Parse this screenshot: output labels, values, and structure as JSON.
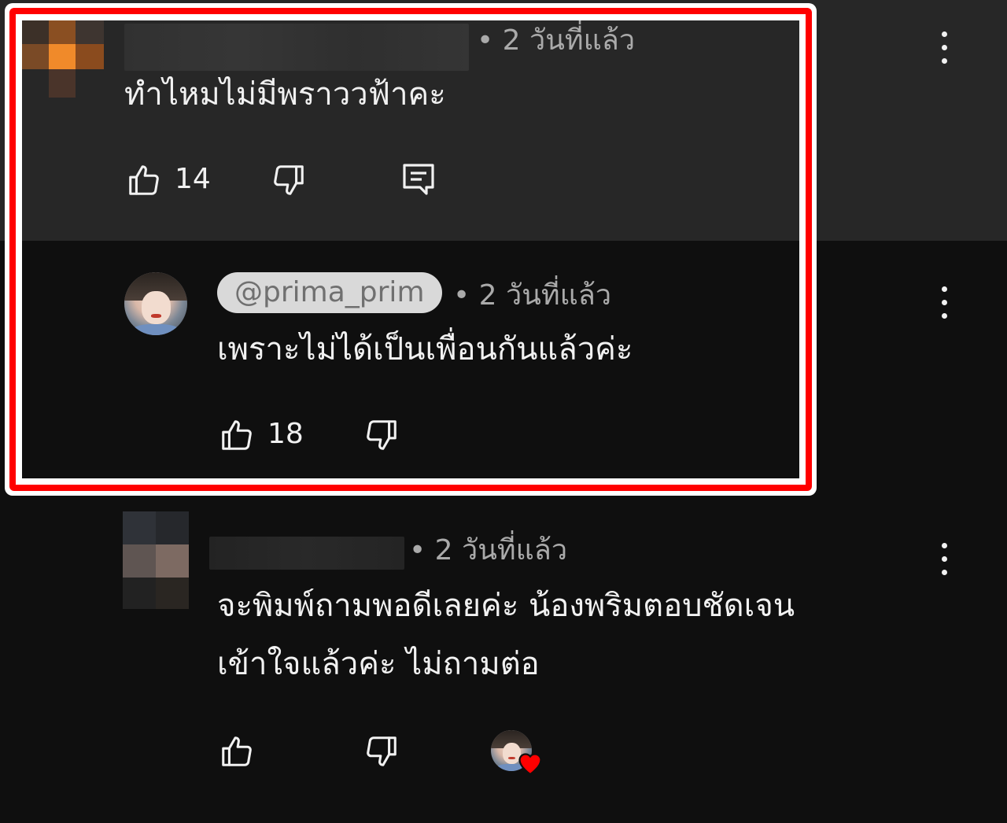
{
  "comments": [
    {
      "time": "• 2 วันที่แล้ว",
      "text": "ทำไหมไม่มีพราววฟ้าคะ",
      "likes": "14"
    },
    {
      "author": "@prima_prim",
      "time": "• 2 วันที่แล้ว",
      "text": "เพราะไม่ได้เป็นเพื่อนกันแล้วค่ะ",
      "likes": "18"
    },
    {
      "time": "• 2 วันที่แล้ว",
      "text_line1": "จะพิมพ์ถามพอดีเลยค่ะ น้องพริมตอบชัดเจน",
      "text_line2": "เข้าใจแล้วค่ะ ไม่ถามต่อ"
    }
  ],
  "colors": {
    "highlight_border": "#ff0000",
    "background": "#0f0f0f",
    "highlighted_comment_bg": "#272727",
    "heart": "#ff0000"
  },
  "icons": [
    "like-icon",
    "dislike-icon",
    "reply-icon",
    "more-vert-icon",
    "creator-heart-icon"
  ]
}
